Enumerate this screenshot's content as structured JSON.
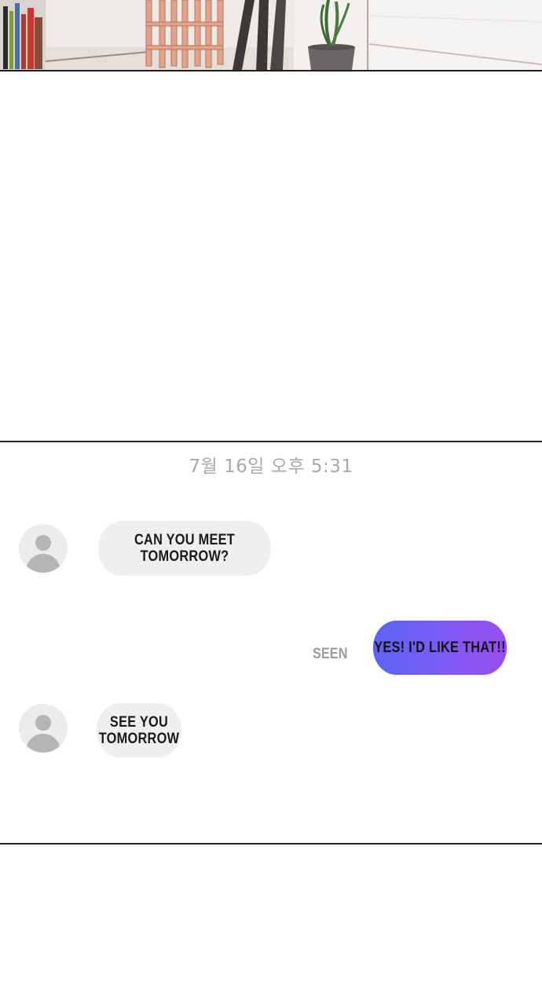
{
  "chat": {
    "timestamp": "7월 16일 오후 5:31",
    "messages": [
      {
        "sender": "other",
        "text": "CAN YOU MEET\nTOMORROW?"
      },
      {
        "sender": "me",
        "text": "YES! I'D LIKE THAT!!",
        "status": "SEEN"
      },
      {
        "sender": "other",
        "text": "SEE YOU\nTOMORROW"
      }
    ]
  },
  "colors": {
    "incoming_bubble": "#efefef",
    "outgoing_bubble_start": "#5b63f2",
    "outgoing_bubble_end": "#9a4cf0",
    "timestamp": "#a9a9a9",
    "seen": "#9c9c9c",
    "avatar_bg": "#ececec",
    "avatar_fg": "#b5b5b5"
  }
}
